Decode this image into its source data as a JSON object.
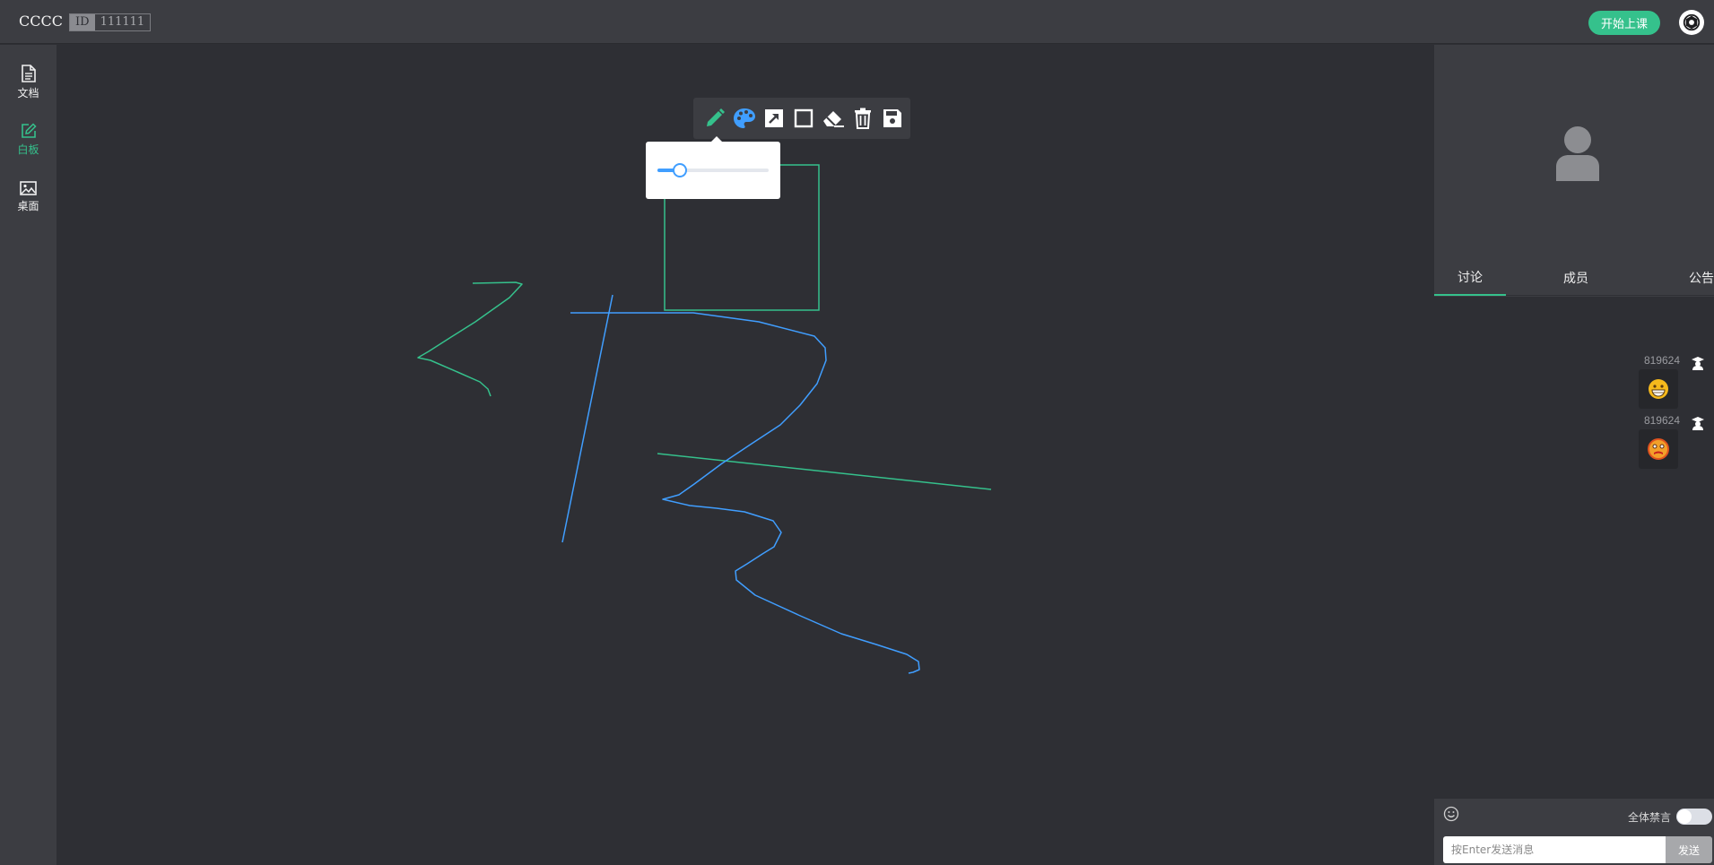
{
  "header": {
    "app_title": "CCCC",
    "room_id_label": "ID",
    "room_id_value": "111111",
    "start_class_label": "开始上课",
    "settings_icon": "settings-icon"
  },
  "sidebar": {
    "items": [
      {
        "label": "文档",
        "icon": "document-icon",
        "active": false
      },
      {
        "label": "白板",
        "icon": "edit-icon",
        "active": true
      },
      {
        "label": "桌面",
        "icon": "image-icon",
        "active": false
      }
    ]
  },
  "whiteboard": {
    "tools": [
      {
        "name": "pencil",
        "icon": "pencil-icon",
        "active": true
      },
      {
        "name": "palette",
        "icon": "palette-icon"
      },
      {
        "name": "arrow",
        "icon": "arrow-icon"
      },
      {
        "name": "rectangle",
        "icon": "rectangle-icon"
      },
      {
        "name": "eraser",
        "icon": "eraser-icon"
      },
      {
        "name": "clear",
        "icon": "trash-icon"
      },
      {
        "name": "save",
        "icon": "save-icon"
      }
    ],
    "brush_size_fraction": 0.2,
    "colors": {
      "green": "#35c18c",
      "blue": "#409eff"
    }
  },
  "right_panel": {
    "tabs": [
      {
        "label": "讨论",
        "active": true
      },
      {
        "label": "成员",
        "active": false
      },
      {
        "label": "公告",
        "active": false
      }
    ],
    "messages": [
      {
        "user": "819624",
        "emoji": "grinning-face-icon"
      },
      {
        "user": "819624",
        "emoji": "angry-face-icon"
      }
    ],
    "mute_all_label": "全体禁言",
    "mute_all_on": false,
    "input_placeholder": "按Enter发送消息",
    "send_label": "发送"
  }
}
